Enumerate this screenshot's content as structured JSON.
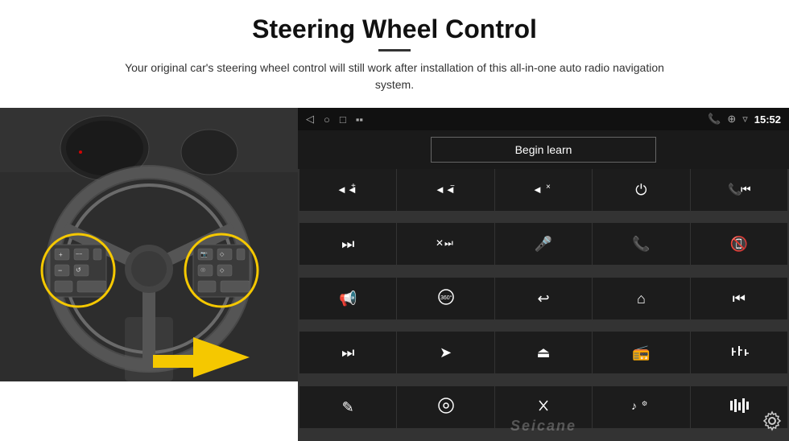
{
  "header": {
    "title": "Steering Wheel Control",
    "subtitle": "Your original car's steering wheel control will still work after installation of this all-in-one auto radio navigation system."
  },
  "status_bar": {
    "time": "15:52",
    "nav_back": "◁",
    "nav_home": "○",
    "nav_recents": "□",
    "signal_icons": "▪▪"
  },
  "begin_learn": {
    "label": "Begin learn"
  },
  "watermark": "Seicane",
  "grid_icons": [
    {
      "id": "vol-up",
      "icon": "🔊+",
      "unicode": ""
    },
    {
      "id": "vol-down",
      "icon": "🔉−",
      "unicode": ""
    },
    {
      "id": "mute",
      "icon": "🔇×",
      "unicode": ""
    },
    {
      "id": "power",
      "icon": "⏻",
      "unicode": ""
    },
    {
      "id": "prev-track",
      "icon": "⏮",
      "unicode": ""
    },
    {
      "id": "skip-forward",
      "icon": "⏭",
      "unicode": ""
    },
    {
      "id": "ff",
      "icon": "⏩",
      "unicode": ""
    },
    {
      "id": "mic",
      "icon": "🎤",
      "unicode": ""
    },
    {
      "id": "phone",
      "icon": "📞",
      "unicode": ""
    },
    {
      "id": "hang-up",
      "icon": "📵",
      "unicode": ""
    },
    {
      "id": "speaker",
      "icon": "📢",
      "unicode": ""
    },
    {
      "id": "360-view",
      "icon": "🔄",
      "unicode": ""
    },
    {
      "id": "back",
      "icon": "↩",
      "unicode": ""
    },
    {
      "id": "home",
      "icon": "⌂",
      "unicode": ""
    },
    {
      "id": "skip-back",
      "icon": "⏮",
      "unicode": ""
    },
    {
      "id": "fast-forward",
      "icon": "⏭",
      "unicode": ""
    },
    {
      "id": "navigate",
      "icon": "➤",
      "unicode": ""
    },
    {
      "id": "eject",
      "icon": "⏏",
      "unicode": ""
    },
    {
      "id": "radio",
      "icon": "📻",
      "unicode": ""
    },
    {
      "id": "equalizer",
      "icon": "🎚",
      "unicode": ""
    },
    {
      "id": "pen",
      "icon": "✎",
      "unicode": ""
    },
    {
      "id": "settings-sub",
      "icon": "⚙",
      "unicode": ""
    },
    {
      "id": "bluetooth",
      "icon": "⚡",
      "unicode": ""
    },
    {
      "id": "music",
      "icon": "♪",
      "unicode": ""
    },
    {
      "id": "bars",
      "icon": "▮▮",
      "unicode": ""
    }
  ],
  "settings_icon": "⚙"
}
